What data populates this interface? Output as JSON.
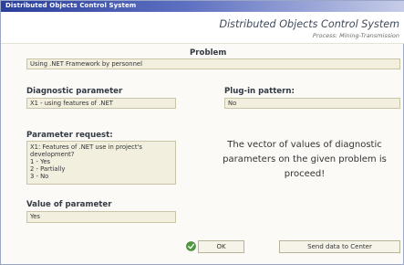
{
  "window": {
    "title": "Distributed Objects Control System"
  },
  "header": {
    "app_title": "Distributed Objects Control System",
    "app_subtitle": "Process: Mining-Transmission"
  },
  "problem": {
    "label": "Problem",
    "value": "Using .NET Framework by personnel"
  },
  "diagnostic": {
    "label": "Diagnostic parameter",
    "value": "X1 - using features of .NET"
  },
  "plugin": {
    "label": "Plug-in pattern:",
    "value": "No"
  },
  "request": {
    "label": "Parameter request:",
    "value": "X1: Features of .NET use in project's\ndevelopment?\n1 - Yes\n2 - Partially\n3 - No"
  },
  "param_value": {
    "label": "Value of parameter",
    "value": "Yes"
  },
  "message": "The vector of values of diagnostic parameters on the given problem is proceed!",
  "buttons": {
    "ok": "OK",
    "send": "Send data to Center"
  },
  "colors": {
    "titlebar": "#2a3f9c",
    "field_bg": "#f2efdf"
  }
}
